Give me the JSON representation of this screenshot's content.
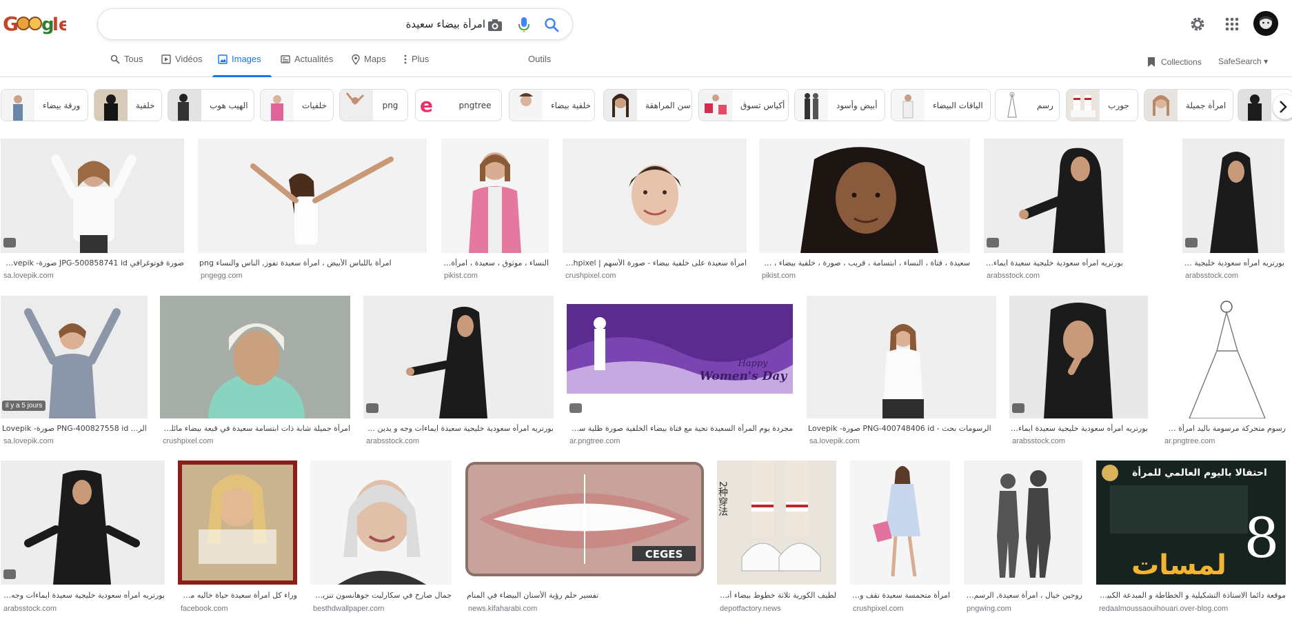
{
  "search": {
    "query": "امرأة بيضاء سعيدة"
  },
  "tabs": [
    {
      "label": "Tous"
    },
    {
      "label": "Vidéos"
    },
    {
      "label": "Images"
    },
    {
      "label": "Actualités"
    },
    {
      "label": "Maps"
    },
    {
      "label": "Plus"
    }
  ],
  "tools_label": "Outils",
  "collections_label": "Collections",
  "safesearch_label": "SafeSearch",
  "chips": [
    {
      "label": "ورقة بيضاء"
    },
    {
      "label": "خلفية"
    },
    {
      "label": "الهيب هوب"
    },
    {
      "label": "خلفيات"
    },
    {
      "label": "png"
    },
    {
      "label": "pngtree"
    },
    {
      "label": "خلفية بيضاء"
    },
    {
      "label": "سن المراهقة"
    },
    {
      "label": "أكياس تسوق"
    },
    {
      "label": "أبيض وأسود"
    },
    {
      "label": "الياقات البيضاء"
    },
    {
      "label": "رسم"
    },
    {
      "label": "جورب"
    },
    {
      "label": "امرأة جميلة"
    }
  ],
  "results": [
    {
      "caption": "صورة فوتوغرافي JPG-500858741 id صورة- Lovepik...",
      "source": "sa.lovepik.com",
      "color": "#ececec"
    },
    {
      "caption": "امرأة باللباس الأبيض ، امرأة سعيدة تفوز, الناس والنساء png",
      "source": "pngegg.com",
      "color": "#f2f2f2"
    },
    {
      "caption": "النساء ، موثوق ، سعيدة ، امرأة واث...",
      "source": "pikist.com",
      "color": "#f4f4f4"
    },
    {
      "caption": "امرأة سعيدة على خلفية بيضاء - صورة الأسهم | Crushpixel",
      "source": "crushpixel.com",
      "color": "#f0f0f0"
    },
    {
      "caption": "سعيدة ، فتاة ، النساء ، ابتسامة ، قريب ، صورة ، خلفية بيضاء ، في سن ا...",
      "source": "pikist.com",
      "color": "#f3f3f3"
    },
    {
      "caption": "بورتريه امرأه سعودية خليجية سعيدة ايماءات وجه و يدين مختلفو...",
      "source": "arabsstock.com",
      "color": "#ededed"
    },
    {
      "caption": "بورتريه امرأه سعودية خليجية سعـ...",
      "source": "arabsstock.com",
      "color": "#ededed"
    },
    {
      "caption": "الر... PNG-400827558 id صورة- Lovepik",
      "source": "sa.lovepik.com",
      "color": "#ececec",
      "time": "il y a 5 jours"
    },
    {
      "caption": "امرأة جميلة شابة ذات ابتسامة سعيدة في قبعة بيضاء مائلة للبد - ...",
      "source": "crushpixel.com",
      "color": "#9aa39d"
    },
    {
      "caption": "بورتريه امرأه سعودية خليجية سعيدة ايماءات وجه و يدين مختلفين...",
      "source": "arabsstock.com",
      "color": "#ededed"
    },
    {
      "caption": "مجردة يوم المرأة السعيدة تحية مع فتاة بيضاء الخلفية صورة ظلية سعيدة, نساء...",
      "source": "ar.pngtree.com",
      "color": "#ffffff",
      "banner_line1": "Happy",
      "banner_line2": "Women's Day"
    },
    {
      "caption": "الرسومات بحث - PNG-400748406 id صورة- Lovepik",
      "source": "sa.lovepik.com",
      "color": "#efefef"
    },
    {
      "caption": "بورتريه امرأه سعودية خليجية سعيدة ايماءات و...",
      "source": "arabsstock.com",
      "color": "#e8e8e8"
    },
    {
      "caption": "رسوم متحركة مرسومة باليد امرأة سعيدة...",
      "source": "ar.pngtree.com",
      "color": "#ffffff"
    },
    {
      "caption": "بورتريه امرأه سعودية خليجية سعيدة ايماءات وجه و يدي...",
      "source": "arabsstock.com",
      "color": "#ededed"
    },
    {
      "caption": "وراء كل امرأة سعيدة حياة خاليه من الر...",
      "source": "facebook.com",
      "color": "#c9b48f"
    },
    {
      "caption": "جمال صارخ في سكارليت جوهانسون تنزيل ه...",
      "source": "besthdwallpaper.com",
      "color": "#f5f5f5"
    },
    {
      "caption": "تفسير حلم رؤية الأسنان البيضاء في المنام",
      "source": "news.kifaharabi.com",
      "color": "#c98a86",
      "brand": "CEGES"
    },
    {
      "caption": "لطيف الكورية ثلاثة خطوط بيضاء أنبو...",
      "source": "depotfactory.news",
      "color": "#e9e4dc",
      "side_text": "2种穿法"
    },
    {
      "caption": "امرأة متحمسة سعيدة تقف وتحمل...",
      "source": "crushpixel.com",
      "color": "#f5f5f5"
    },
    {
      "caption": "زوجين خيال ، امرأة سعيدة, الرسم بالأ...",
      "source": "pngwing.com",
      "color": "#f2f2f2"
    },
    {
      "caption": "موقعة دائما الاستاذة التشكيلية و الخطاطة و المبدعة الكبيرة سعيدة...",
      "source": "redaalmoussaouihouari.over-blog.com",
      "color": "#17231f",
      "poster_title": "احتفالا باليوم العالمي للمرأة",
      "poster_number": "8",
      "poster_word": "لمسات"
    }
  ]
}
